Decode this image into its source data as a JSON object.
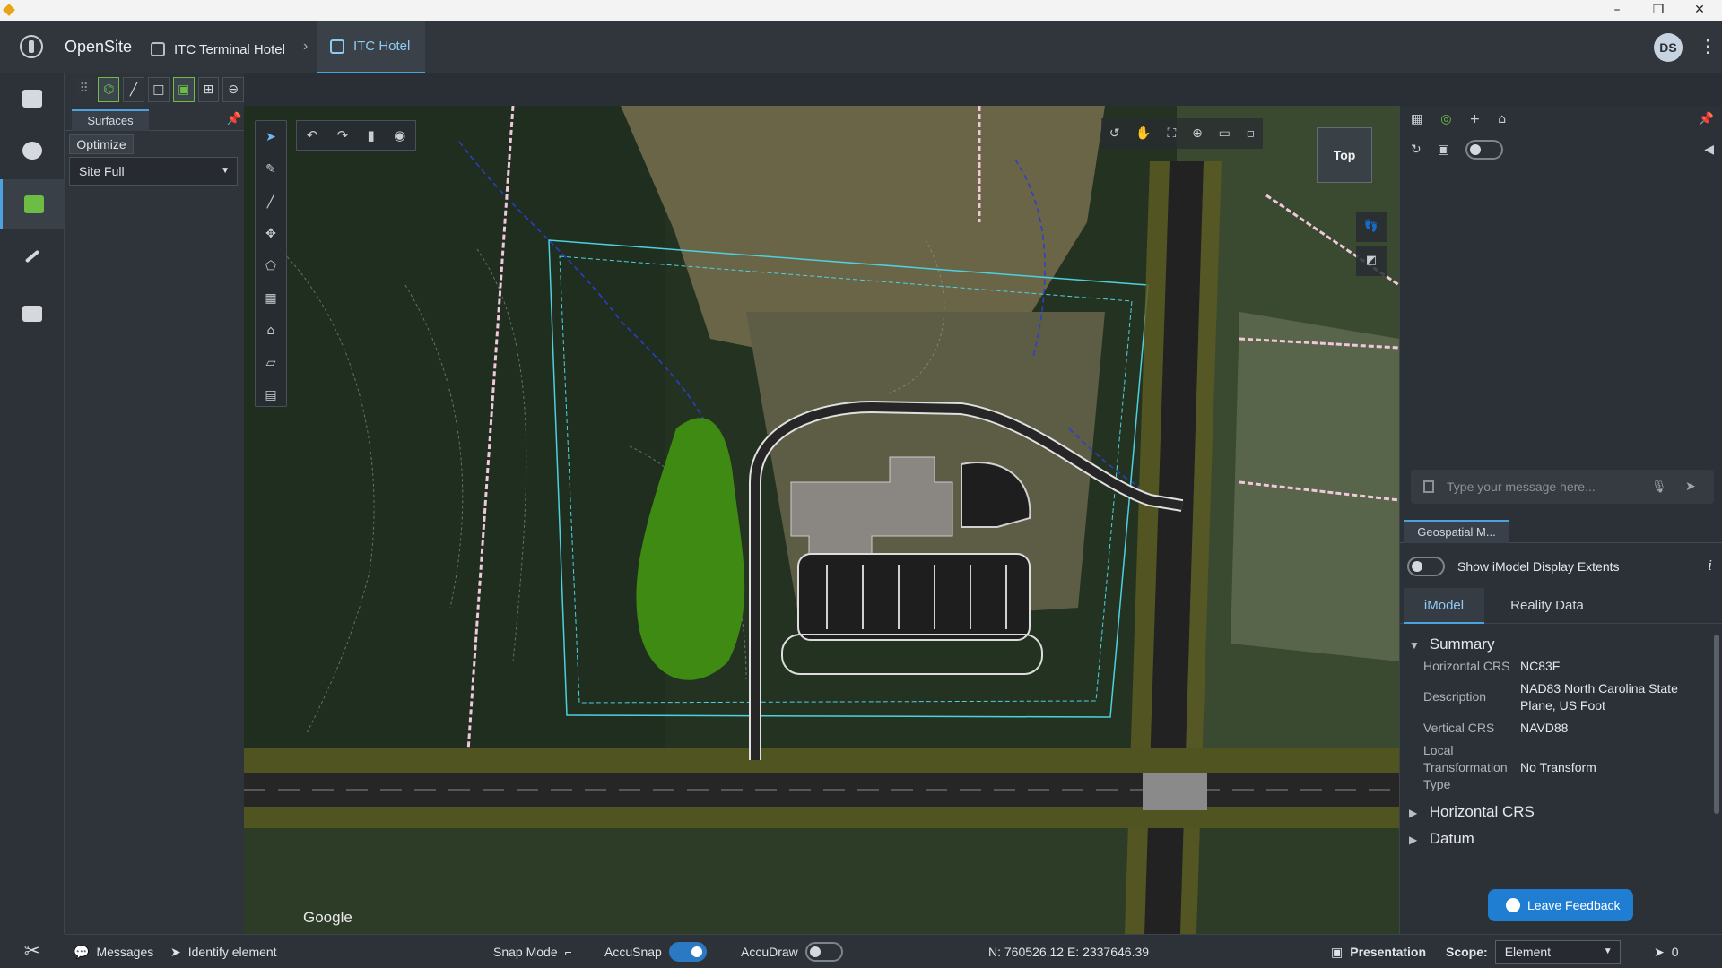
{
  "window": {
    "minimize": "–",
    "maximize": "❐",
    "close": "✕"
  },
  "header": {
    "brand": "OpenSite",
    "breadcrumb": [
      "ITC Terminal Hotel",
      "ITC Hotel"
    ],
    "separator": "›",
    "avatar_initials": "DS",
    "more": "⋮"
  },
  "rail": {
    "items": [
      "models-icon",
      "info-icon",
      "surfaces-icon",
      "edit-icon",
      "toolbox-icon"
    ]
  },
  "panel": {
    "tab": "Surfaces",
    "optimize_label": "Optimize",
    "select_value": "Site Full"
  },
  "viewport": {
    "view_cube_label": "Top",
    "google_label": "Google",
    "undo": "↶",
    "redo": "↷",
    "delete": "🗑",
    "eye": "👁"
  },
  "right_panel": {
    "message_placeholder": "Type your message here...",
    "geo_tab": "Geospatial M...",
    "extents_label": "Show iModel Display Extents",
    "tabs": [
      "iModel",
      "Reality Data"
    ],
    "summary_title": "Summary",
    "properties": [
      {
        "key": "Horizontal CRS",
        "value": "NC83F"
      },
      {
        "key": "Description",
        "value": "NAD83 North Carolina State Plane, US Foot"
      },
      {
        "key": "Vertical CRS",
        "value": "NAVD88"
      },
      {
        "key": "Local Transformation Type",
        "value": "No Transform"
      }
    ],
    "collapsed_sections": [
      "Horizontal CRS",
      "Datum"
    ],
    "feedback_label": "Leave Feedback"
  },
  "statusbar": {
    "messages": "Messages",
    "identify": "Identify element",
    "snap_mode": "Snap Mode",
    "accusnap": "AccuSnap",
    "accusnap_on": true,
    "accudraw": "AccuDraw",
    "accudraw_on": false,
    "coordinates": "N: 760526.12 E: 2337646.39",
    "presentation": "Presentation",
    "scope_label": "Scope:",
    "scope_value": "Element",
    "selection_count": "0"
  },
  "colors": {
    "accent": "#4aa3df",
    "active_green": "#6dbd45",
    "site_boundary": "#4fd0e0",
    "vegetation": "#3f8a12"
  }
}
